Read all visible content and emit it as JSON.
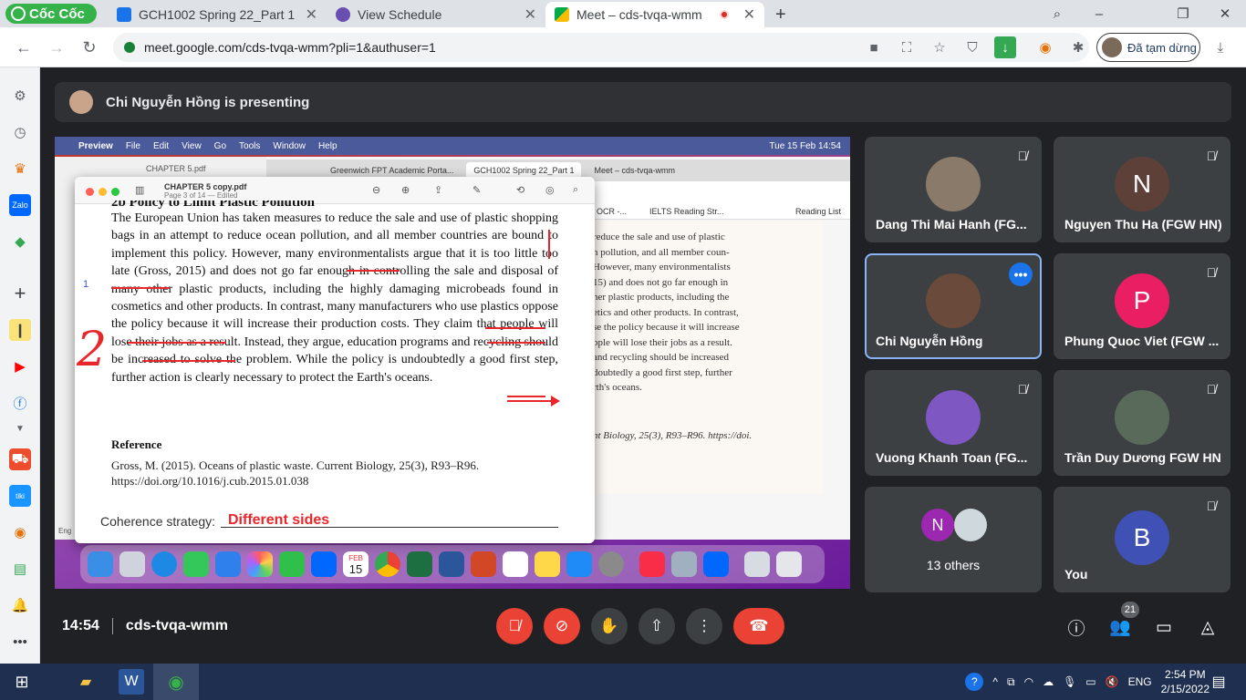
{
  "browser": {
    "logo_text": "Cốc Cốc",
    "tabs": [
      {
        "title": "GCH1002 Spring 22_Part 1",
        "icon": "classroom-icon"
      },
      {
        "title": "View Schedule",
        "icon": "globe-icon"
      },
      {
        "title": "Meet – cds-tvqa-wmm",
        "icon": "meet-icon",
        "active": true
      }
    ],
    "new_tab": "+",
    "url": "meet.google.com/cds-tvqa-wmm?pli=1&authuser=1",
    "profile_status": "Đã tạm dừng",
    "window_controls": [
      "–",
      "❐",
      "✕"
    ]
  },
  "presenting": {
    "text": "Chi Nguyễn Hồng is presenting"
  },
  "shared_screen": {
    "menubar": [
      "Preview",
      "File",
      "Edit",
      "View",
      "Go",
      "Tools",
      "Window",
      "Help"
    ],
    "menubar_date": "Tue 15 Feb 14:54",
    "bg_tabs": [
      "Greenwich FPT Academic Porta...",
      "GCH1002 Spring 22_Part 1",
      "Meet – cds-tvqa-wmm"
    ],
    "bg_bookmarks": [
      "OCR -...",
      "IELTS Reading Str...",
      "Reading List"
    ],
    "bg_window_title": "CHAPTER 5.pdf",
    "bg_doc_lines": [
      "reduce the sale and use of plastic",
      "n pollution, and all member coun-",
      "However, many environmentalists",
      "15) and does not go far enough in",
      "her plastic products, including the",
      "etics and other products. In contrast,",
      "se the policy because it will increase",
      "ople will lose their jobs as a result.",
      "and recycling should be increased",
      "doubtedly a good first step, further",
      "rth's oceans.",
      "nt Biology, 25(3), R93–R96. https://doi."
    ],
    "pdf_title": "CHAPTER 5 copy.pdf",
    "pdf_subtitle": "Page 3 of 14 — Edited",
    "pdf_heading": "2b Policy to Limit Plastic Pollution",
    "pdf_paragraph": "The European Union has taken measures to reduce the sale and use of plastic shopping bags in an attempt to reduce ocean pollution, and all member countries are bound to implement this policy. However, many environmentalists argue that it is too little too late (Gross, 2015) and does not go far enough in controlling the sale and disposal of many other plastic products, including the highly damaging microbeads found in cosmetics and other products. In contrast, many manufacturers who use plastics oppose the policy because it will increase their production costs. They claim that people will lose their jobs as a result. Instead, they argue, education programs and recycling should be increased to solve the problem. While the policy is undoubtedly a good first step, further action is clearly necessary to protect the Earth's oceans.",
    "line_number": "1",
    "annotation_number": "2",
    "reference_heading": "Reference",
    "reference_text": "Gross, M. (2015). Oceans of plastic waste. Current Biology, 25(3), R93–R96. https://doi.org/10.1016/j.cub.2015.01.038",
    "coherence_label": "Coherence strategy:",
    "coherence_value": "Different sides",
    "dock_calendar_month": "FEB",
    "dock_calendar_day": "15",
    "bottom_left": "Eng"
  },
  "participants": [
    {
      "name": "Dang Thi Mai Hanh (FG...",
      "avatar": "photo",
      "muted": true,
      "color": "#8a7a6a"
    },
    {
      "name": "Nguyen Thu Ha (FGW HN)",
      "avatar": "N",
      "muted": true,
      "color": "#5d4037"
    },
    {
      "name": "Chi Nguyễn Hồng",
      "avatar": "photo",
      "muted": false,
      "speaking": true,
      "color": "#6a4a3a"
    },
    {
      "name": "Phung Quoc Viet (FGW ...",
      "avatar": "P",
      "muted": true,
      "color": "#e91e63"
    },
    {
      "name": "Vuong Khanh Toan (FG...",
      "avatar": "photo",
      "muted": true,
      "color": "#7e57c2"
    },
    {
      "name": "Trần Duy Dương FGW HN",
      "avatar": "photo",
      "muted": true,
      "color": "#5a6a5a"
    },
    {
      "name": "13 others",
      "avatar": "N",
      "muted": false,
      "color": "#9c27b0"
    },
    {
      "name": "You",
      "avatar": "B",
      "muted": true,
      "color": "#3f51b5"
    }
  ],
  "meeting": {
    "time": "14:54",
    "code": "cds-tvqa-wmm",
    "people_count": "21"
  },
  "taskbar": {
    "lang": "ENG",
    "time": "2:54 PM",
    "date": "2/15/2022"
  }
}
